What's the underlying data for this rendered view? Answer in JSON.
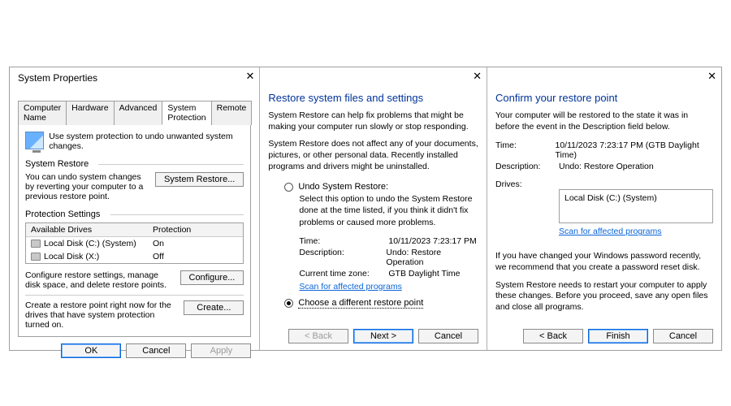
{
  "panel1": {
    "title": "System Properties",
    "tabs": [
      "Computer Name",
      "Hardware",
      "Advanced",
      "System Protection",
      "Remote"
    ],
    "active_tab": 3,
    "intro": "Use system protection to undo unwanted system changes.",
    "section_restore": "System Restore",
    "restore_desc": "You can undo system changes by reverting your computer to a previous restore point.",
    "btn_system_restore": "System Restore...",
    "section_protection": "Protection Settings",
    "table_headers": {
      "drive": "Available Drives",
      "protection": "Protection"
    },
    "drives": [
      {
        "name": "Local Disk (C:) (System)",
        "protection": "On"
      },
      {
        "name": "Local Disk (X:)",
        "protection": "Off"
      }
    ],
    "configure_desc": "Configure restore settings, manage disk space, and delete restore points.",
    "btn_configure": "Configure...",
    "create_desc": "Create a restore point right now for the drives that have system protection turned on.",
    "btn_create": "Create...",
    "btn_ok": "OK",
    "btn_cancel": "Cancel",
    "btn_apply": "Apply"
  },
  "panel2": {
    "heading": "Restore system files and settings",
    "para1": "System Restore can help fix problems that might be making your computer run slowly or stop responding.",
    "para2": "System Restore does not affect any of your documents, pictures, or other personal data. Recently installed programs and drivers might be uninstalled.",
    "opt_undo": "Undo System Restore:",
    "undo_desc": "Select this option to undo the System Restore done at the time listed, if you think it didn't fix problems or caused more problems.",
    "time_label": "Time:",
    "time_value": "10/11/2023 7:23:17 PM",
    "desc_label": "Description:",
    "desc_value": "Undo: Restore Operation",
    "tz_label": "Current time zone:",
    "tz_value": "GTB Daylight Time",
    "scan_link": "Scan for affected programs",
    "opt_choose": "Choose a different restore point",
    "btn_back": "< Back",
    "btn_next": "Next >",
    "btn_cancel": "Cancel"
  },
  "panel3": {
    "heading": "Confirm your restore point",
    "para1": "Your computer will be restored to the state it was in before the event in the Description field below.",
    "time_label": "Time:",
    "time_value": "10/11/2023 7:23:17 PM (GTB Daylight Time)",
    "desc_label": "Description:",
    "desc_value": "Undo: Restore Operation",
    "drives_label": "Drives:",
    "drive_value": "Local Disk (C:) (System)",
    "scan_link": "Scan for affected programs",
    "pw_para": "If you have changed your Windows password recently, we recommend that you create a password reset disk.",
    "restart_para": "System Restore needs to restart your computer to apply these changes. Before you proceed, save any open files and close all programs.",
    "btn_back": "< Back",
    "btn_finish": "Finish",
    "btn_cancel": "Cancel"
  }
}
